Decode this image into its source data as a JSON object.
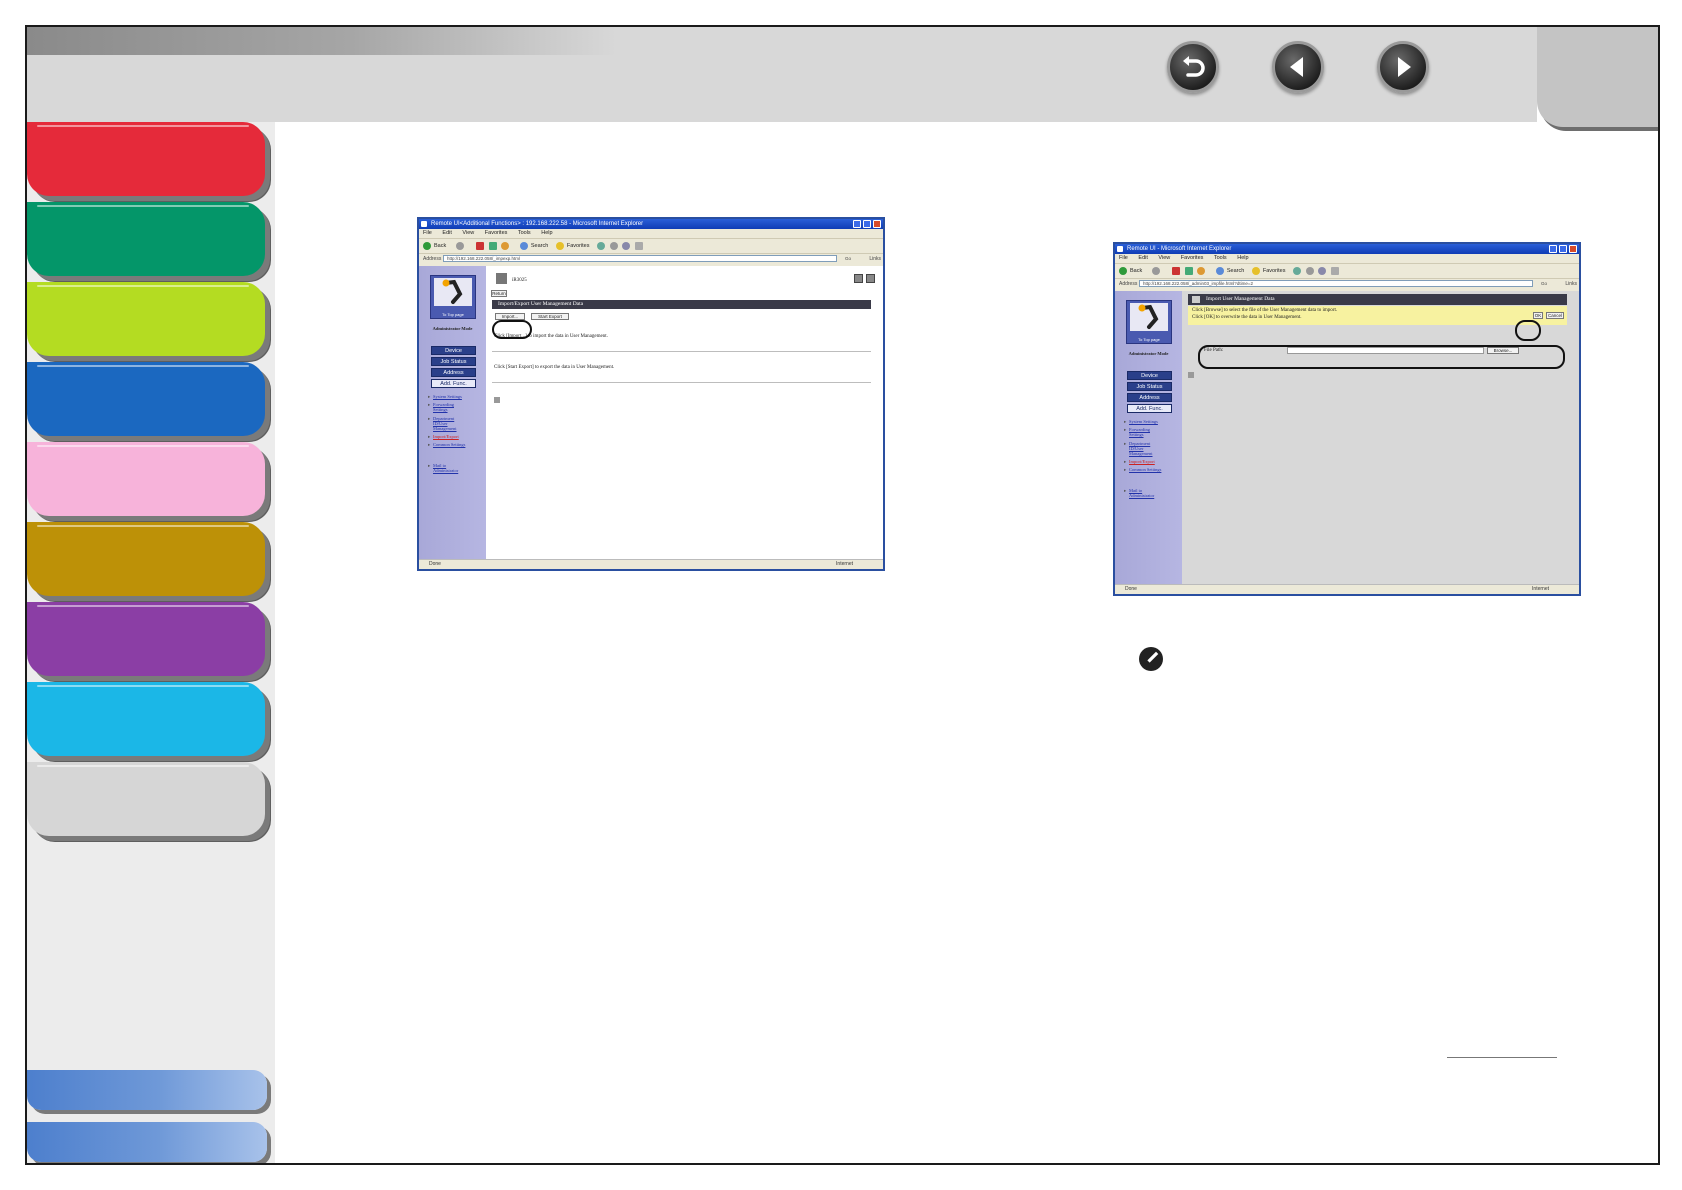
{
  "window1": {
    "title": "Remote UI<Additional Functions> : 192.168.222.58 - Microsoft Internet Explorer",
    "menu": [
      "File",
      "Edit",
      "View",
      "Favorites",
      "Tools",
      "Help"
    ],
    "toolbar": {
      "back": "Back",
      "search": "Search",
      "favorites": "Favorites"
    },
    "address_label": "Address",
    "address_url": "http://192.168.222.058/_impexp.html",
    "go": "Go",
    "links": "Links",
    "logo_label": "To Top page",
    "admin_mode": "Administrator Mode",
    "menu_buttons": [
      "Device",
      "Job Status",
      "Address",
      "Add. Func."
    ],
    "side_links": [
      "System Settings",
      "Forwarding Settings",
      "Department ID/User Management",
      "Import/Export",
      "Common Settings"
    ],
    "mail_link": "Mail to Administrator",
    "device_name": "iR3025",
    "small_label": "Return",
    "header": "Import/Export User Management Data",
    "import_btn": "Import...",
    "export_btn": "Start Export",
    "msg1": "Click [Import...] to import the data in User Management.",
    "msg2": "Click [Start Export] to export the data in User Management.",
    "status": "Done",
    "status_zone": "Internet"
  },
  "window2": {
    "title": "Remote UI - Microsoft Internet Explorer",
    "menu": [
      "File",
      "Edit",
      "View",
      "Favorites",
      "Tools",
      "Help"
    ],
    "toolbar": {
      "back": "Back",
      "search": "Search",
      "favorites": "Favorites"
    },
    "address_label": "Address",
    "address_url": "http://192.168.222.058/_admin03_impfile.html?dtime=2",
    "go": "Go",
    "links": "Links",
    "logo_label": "To Top page",
    "admin_mode": "Administrator Mode",
    "menu_buttons": [
      "Device",
      "Job Status",
      "Address",
      "Add. Func."
    ],
    "side_links": [
      "System Settings",
      "Forwarding Settings",
      "Department ID/User Management",
      "Import/Export",
      "Common Settings"
    ],
    "mail_link": "Mail to Administrator",
    "header": "Import User Management Data",
    "instr1": "Click [Browse] to select the file of the User Management data to import.",
    "instr2": "Click [OK] to overwrite the data in User Management.",
    "ok_btn": "OK",
    "cancel_btn": "Cancel",
    "file_path_label": "File Path:",
    "browse_btn": "Browse...",
    "status": "Done",
    "status_zone": "Internet"
  },
  "colors": {
    "tabs": [
      "#e52a3a",
      "#049669",
      "#b4dc22",
      "#1b68c0",
      "#f7b3da",
      "#bd9107",
      "#8b3ea5",
      "#1bb7e7",
      "#d6d6d6"
    ],
    "bottom_tab_gradient": [
      "#4d7fcd",
      "#a8c2ea"
    ]
  },
  "icons": [
    "back-icon",
    "previous-page-icon",
    "next-page-icon",
    "note-pencil-icon"
  ]
}
